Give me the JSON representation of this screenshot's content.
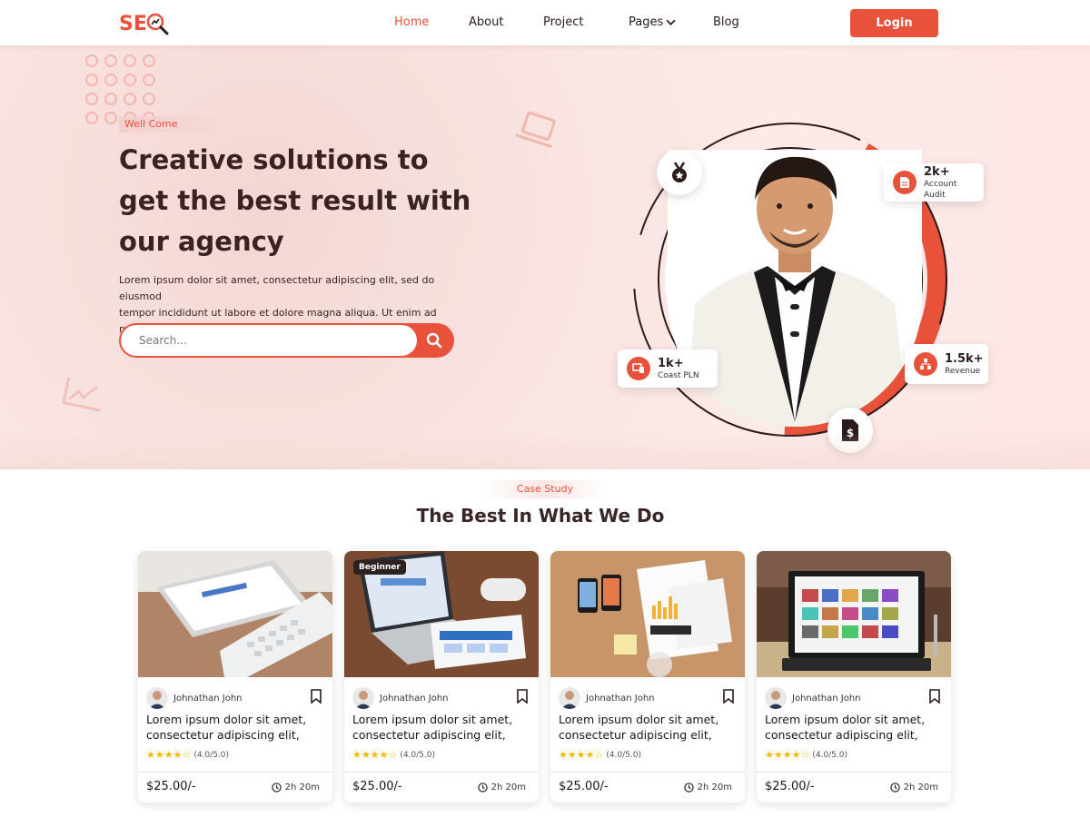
{
  "brand": {
    "logo_text": "SE"
  },
  "nav": {
    "items": [
      {
        "label": "Home"
      },
      {
        "label": "About"
      },
      {
        "label": "Project"
      },
      {
        "label": "Pages"
      },
      {
        "label": "Blog"
      }
    ],
    "login_label": "Login"
  },
  "hero": {
    "tag": "Well Come",
    "title_lines": [
      "Creative solutions to",
      "get the best result with",
      "our agency"
    ],
    "description_lines": [
      "Lorem ipsum dolor sit amet, consectetur adipiscing elit, sed do eiusmod",
      "tempor incididunt ut labore et dolore magna aliqua. Ut enim ad minim."
    ],
    "search_placeholder": "Search..."
  },
  "stats": [
    {
      "value": "2k+",
      "label": "Account Audit",
      "icon": "document-icon"
    },
    {
      "value": "1k+",
      "label": "Coast PLN",
      "icon": "devices-icon"
    },
    {
      "value": "1.5k+",
      "label": "Revenue",
      "icon": "network-icon"
    }
  ],
  "section": {
    "tag": "Case Study",
    "title": "The Best In What We Do"
  },
  "cards": [
    {
      "badge": "",
      "author": "Johnathan John",
      "title_lines": [
        "Lorem ipsum dolor sit amet,",
        "consectetur adipiscing elit,"
      ],
      "rating_text": "(4.0/5.0)",
      "rating": 4,
      "price": "$25.00/-",
      "duration": "2h 20m"
    },
    {
      "badge": "Beginner",
      "author": "Johnathan John",
      "title_lines": [
        "Lorem ipsum dolor sit amet,",
        "consectetur adipiscing elit,"
      ],
      "rating_text": "(4.0/5.0)",
      "rating": 4,
      "price": "$25.00/-",
      "duration": "2h 20m"
    },
    {
      "badge": "",
      "author": "Johnathan John",
      "title_lines": [
        "Lorem ipsum dolor sit amet,",
        "consectetur adipiscing elit,"
      ],
      "rating_text": "(4.0/5.0)",
      "rating": 4,
      "price": "$25.00/-",
      "duration": "2h 20m"
    },
    {
      "badge": "",
      "author": "Johnathan John",
      "title_lines": [
        "Lorem ipsum dolor sit amet,",
        "consectetur adipiscing elit,"
      ],
      "rating_text": "(4.0/5.0)",
      "rating": 4,
      "price": "$25.00/-",
      "duration": "2h 20m"
    }
  ],
  "colors": {
    "accent": "#e8523b",
    "dark": "#3a2222",
    "star": "#f6b800"
  }
}
